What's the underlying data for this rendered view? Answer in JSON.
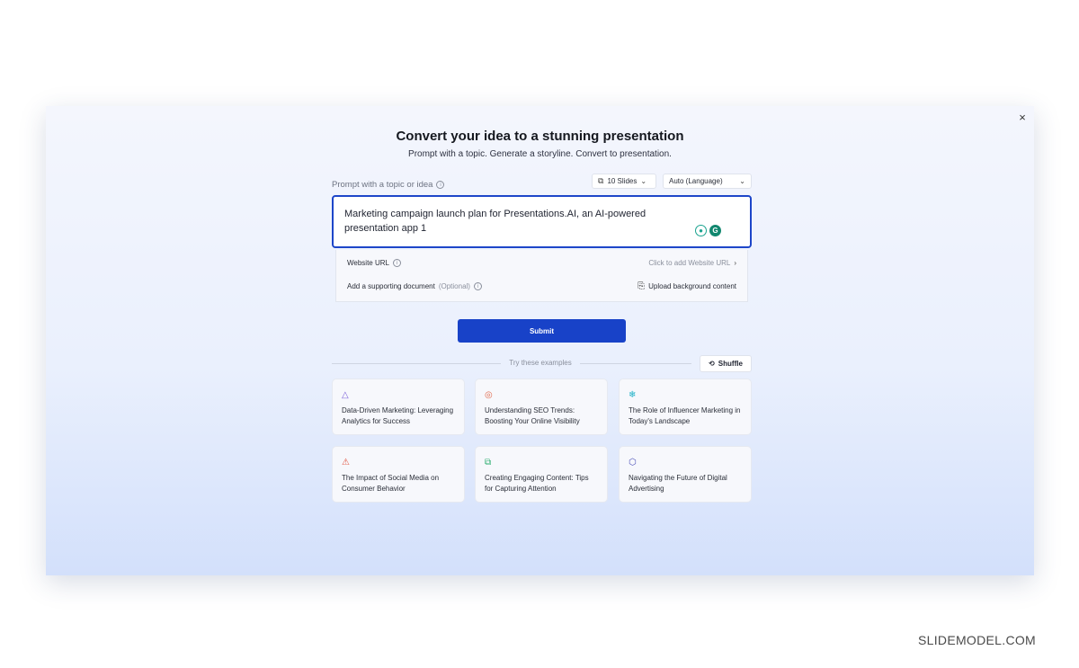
{
  "dialog": {
    "close_label": "×",
    "title": "Convert your idea to a stunning presentation",
    "subtitle": "Prompt with a topic. Generate a storyline. Convert to presentation."
  },
  "prompt": {
    "label": "Prompt with a topic or idea",
    "value": "Marketing campaign launch plan for Presentations.AI, an AI-powered presentation app 1",
    "slides_select": "10 Slides",
    "language_select": "Auto (Language)"
  },
  "options": {
    "website_label": "Website URL",
    "website_action": "Click to add Website URL",
    "document_label": "Add a supporting document",
    "document_optional": "(Optional)",
    "upload_action": "Upload background content"
  },
  "submit_label": "Submit",
  "examples": {
    "header": "Try these examples",
    "shuffle_label": "Shuffle",
    "cards": [
      {
        "text": "Data-Driven Marketing: Leveraging Analytics for Success",
        "icon": "triangle-nodes-icon",
        "color": "#7b5fd9"
      },
      {
        "text": "Understanding SEO Trends: Boosting Your Online Visibility",
        "icon": "target-icon",
        "color": "#e0684a"
      },
      {
        "text": "The Role of Influencer Marketing in Today's Landscape",
        "icon": "snowflake-icon",
        "color": "#1fb1c7"
      },
      {
        "text": "The Impact of Social Media on Consumer Behavior",
        "icon": "warning-icon",
        "color": "#e0533f"
      },
      {
        "text": "Creating Engaging Content: Tips for Capturing Attention",
        "icon": "layers-icon",
        "color": "#2fae72"
      },
      {
        "text": "Navigating the Future of Digital Advertising",
        "icon": "cube-icon",
        "color": "#4b4fb8"
      }
    ]
  },
  "watermark": "SLIDEMODEL.COM"
}
